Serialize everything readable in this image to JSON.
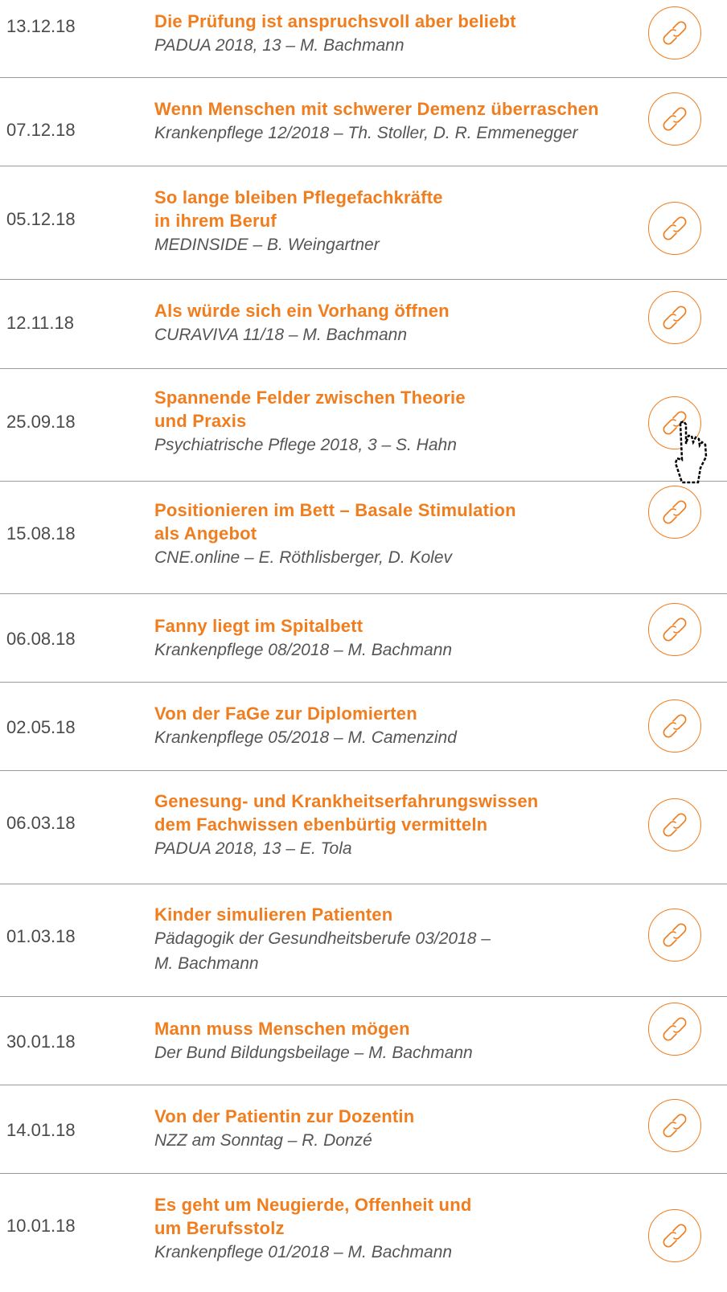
{
  "theme": {
    "accent": "#f07d1e",
    "divider": "#9b9b9b",
    "date_color": "#4a4a4a",
    "source_color": "#555555"
  },
  "articles": [
    {
      "date": "13.12.18",
      "title": "Die Prüfung ist anspruchsvoll aber beliebt",
      "source": "PADUA 2018, 13 – M. Bachmann",
      "icon": "link-icon"
    },
    {
      "date": "07.12.18",
      "title": "Wenn Menschen mit schwerer Demenz überraschen",
      "source": "Krankenpflege 12/2018 – Th. Stoller, D. R. Emmenegger",
      "icon": "link-icon"
    },
    {
      "date": "05.12.18",
      "title": "So lange bleiben Pflegefachkräfte\nin ihrem Beruf",
      "source": "MEDINSIDE – B. Weingartner",
      "icon": "link-icon"
    },
    {
      "date": "12.11.18",
      "title": "Als würde sich ein Vorhang öffnen",
      "source": "CURAVIVA 11/18 – M. Bachmann",
      "icon": "link-icon"
    },
    {
      "date": "25.09.18",
      "title": "Spannende Felder zwischen Theorie\nund Praxis",
      "source": "Psychiatrische Pflege 2018, 3 – S. Hahn",
      "icon": "link-icon"
    },
    {
      "date": "15.08.18",
      "title": "Positionieren im Bett – Basale Stimulation\nals Angebot",
      "source": "CNE.online – E. Röthlisberger, D. Kolev",
      "icon": "link-icon"
    },
    {
      "date": "06.08.18",
      "title": "Fanny liegt im Spitalbett",
      "source": "Krankenpflege 08/2018 – M. Bachmann",
      "icon": "link-icon"
    },
    {
      "date": "02.05.18",
      "title": "Von der FaGe zur Diplomierten",
      "source": "Krankenpflege 05/2018 – M. Camenzind",
      "icon": "link-icon"
    },
    {
      "date": "06.03.18",
      "title": "Genesung- und Krankheitserfahrungswissen\ndem Fachwissen ebenbürtig vermitteln",
      "source": "PADUA 2018, 13 – E. Tola",
      "icon": "link-icon"
    },
    {
      "date": "01.03.18",
      "title": "Kinder simulieren Patienten",
      "source": "Pädagogik der Gesundheitsberufe 03/2018 –\nM. Bachmann",
      "icon": "link-icon"
    },
    {
      "date": "30.01.18",
      "title": "Mann muss Menschen mögen",
      "source": "Der Bund Bildungsbeilage – M. Bachmann",
      "icon": "link-icon"
    },
    {
      "date": "14.01.18",
      "title": "Von der Patientin zur Dozentin",
      "source": "NZZ am Sonntag – R. Donzé",
      "icon": "link-icon"
    },
    {
      "date": "10.01.18",
      "title": "Es geht um Neugierde, Offenheit und\num Berufsstolz",
      "source": "Krankenpflege 01/2018 – M. Bachmann",
      "icon": "link-icon"
    }
  ]
}
